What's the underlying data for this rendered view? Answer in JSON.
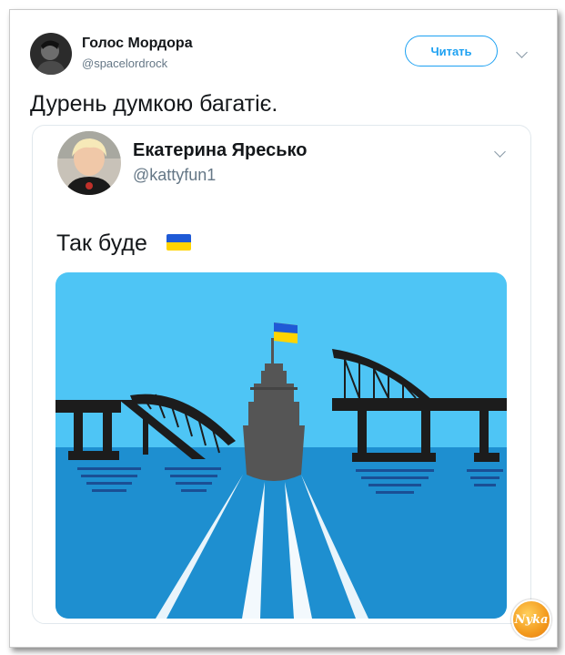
{
  "outer_tweet": {
    "author_name": "Голос Мордора",
    "author_handle": "@spacelordrock",
    "follow_label": "Читать",
    "text": "Дурень думкою багатіє."
  },
  "quoted_tweet": {
    "author_name": "Екатерина Яресько",
    "author_handle": "@kattyfun1",
    "text": "Так буде",
    "flag_emoji": "ukraine-flag",
    "image_description_icon": "ship-passing-broken-bridge-illustration"
  },
  "colors": {
    "accent": "#1da1f2",
    "sky": "#4ec5f5",
    "sea": "#1e8fd0",
    "silhouette": "#1c1c1c",
    "ship": "#555555",
    "flag_blue": "#1f5ad6",
    "flag_yellow": "#ffd400"
  },
  "watermark": {
    "text": "Nyka"
  }
}
